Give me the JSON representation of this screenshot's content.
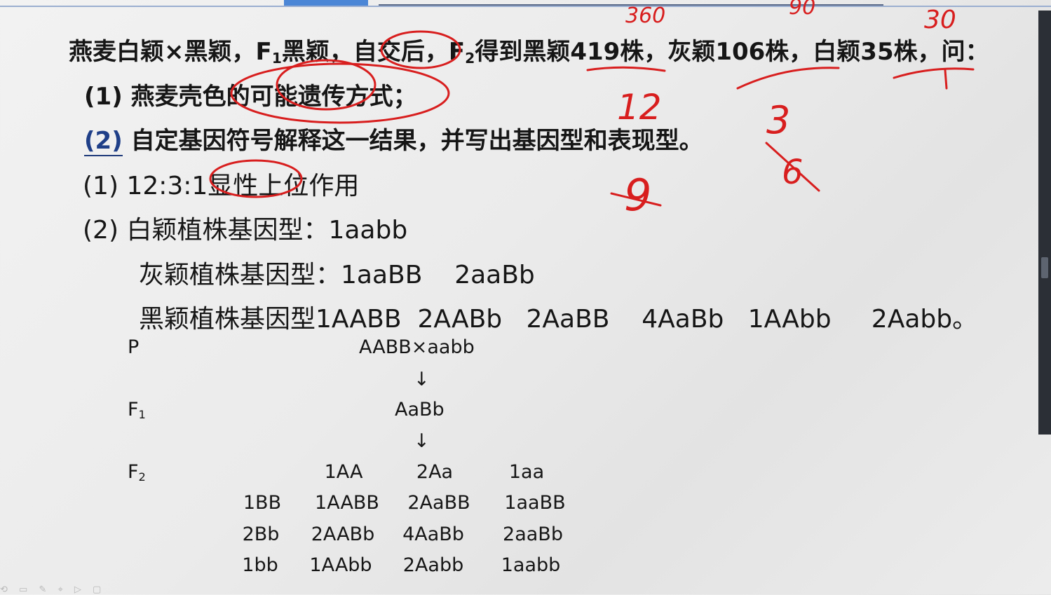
{
  "question": {
    "line1_prefix": "燕麦白颖×黑颖，F",
    "line1_sub1": "1",
    "line1_mid": "黑颖，自交后，F",
    "line1_sub2": "2",
    "line1_suffix": "得到黑颖419株，灰颖106株，白颖35株，问：",
    "part1_num": "(1)",
    "part1_text": "燕麦壳色的可能遗传方式；",
    "part2_num": "(2)",
    "part2_text": "自定基因符号解释这一结果，并写出基因型和表现型。"
  },
  "answer": {
    "a1_num": "(1)",
    "a1_text": "12:3:1显性上位作用",
    "a2_num": "(2)",
    "white": "白颖植株基因型：1aabb",
    "gray": "灰颖植株基因型：1aaBB    2aaBb",
    "black": "黑颖植株基因型1AABB  2AABb   2AaBB    4AaBb   1AAbb     2Aabb。"
  },
  "cross": {
    "p_label": "P",
    "p_cross": "AABB×aabb",
    "arrow": "↓",
    "f1_label": "F",
    "f1_sub": "1",
    "f1_genotype": "AaBb",
    "f2_label": "F",
    "f2_sub": "2",
    "col_headers": [
      "1AA",
      "2Aa",
      "1aa"
    ],
    "rows": [
      {
        "label": "1BB",
        "cells": [
          "1AABB",
          "2AaBB",
          "1aaBB"
        ]
      },
      {
        "label": "2Bb",
        "cells": [
          "2AABb",
          "4AaBb",
          "2aaBb"
        ]
      },
      {
        "label": "1bb",
        "cells": [
          "1AAbb",
          "2Aabb",
          "1aabb"
        ]
      }
    ]
  },
  "handwriting": {
    "top1": "360",
    "top2": "90",
    "top3": "30",
    "r1": "12",
    "r2": "3",
    "r3": "9",
    "r4": "6"
  },
  "colors": {
    "ink": "#d81e1e",
    "accent": "#1f3f88",
    "text": "#161616"
  }
}
